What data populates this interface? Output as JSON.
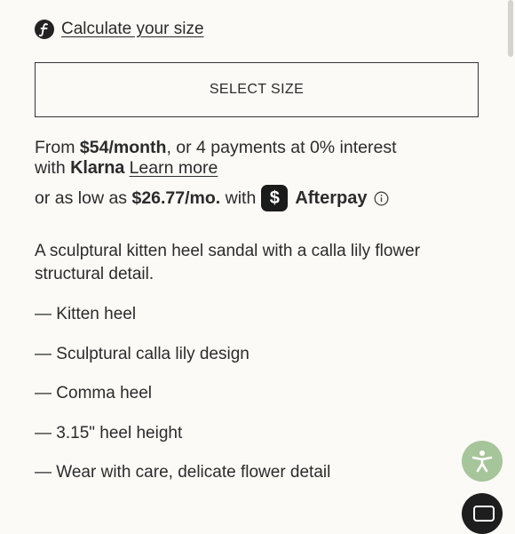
{
  "size_calculator": {
    "label": "Calculate your size",
    "icon": "f-logo-icon"
  },
  "select_size": {
    "label": "SELECT SIZE"
  },
  "klarna": {
    "from_text": "From ",
    "monthly_price": "$54/month",
    "installments_text": ", or 4 payments at 0% interest",
    "with_text": "with ",
    "brand": "Klarna",
    "learn_more": "Learn more"
  },
  "afterpay": {
    "prefix": "or as low as ",
    "price": "$26.77/mo.",
    "with_text": " with",
    "badge": "$",
    "brand": "Afterpay",
    "info_icon": "info-icon"
  },
  "description": "A sculptural kitten heel sandal with a calla lily flower structural detail.",
  "features": [
    "— Kitten heel",
    "— Sculptural calla lily design",
    "— Comma heel",
    "— 3.15\" heel height",
    "— Wear with care, delicate flower detail"
  ],
  "colors": {
    "background": "#fbfaf6",
    "text": "#2b2b2b",
    "accessibility_button": "#a6c59a"
  }
}
